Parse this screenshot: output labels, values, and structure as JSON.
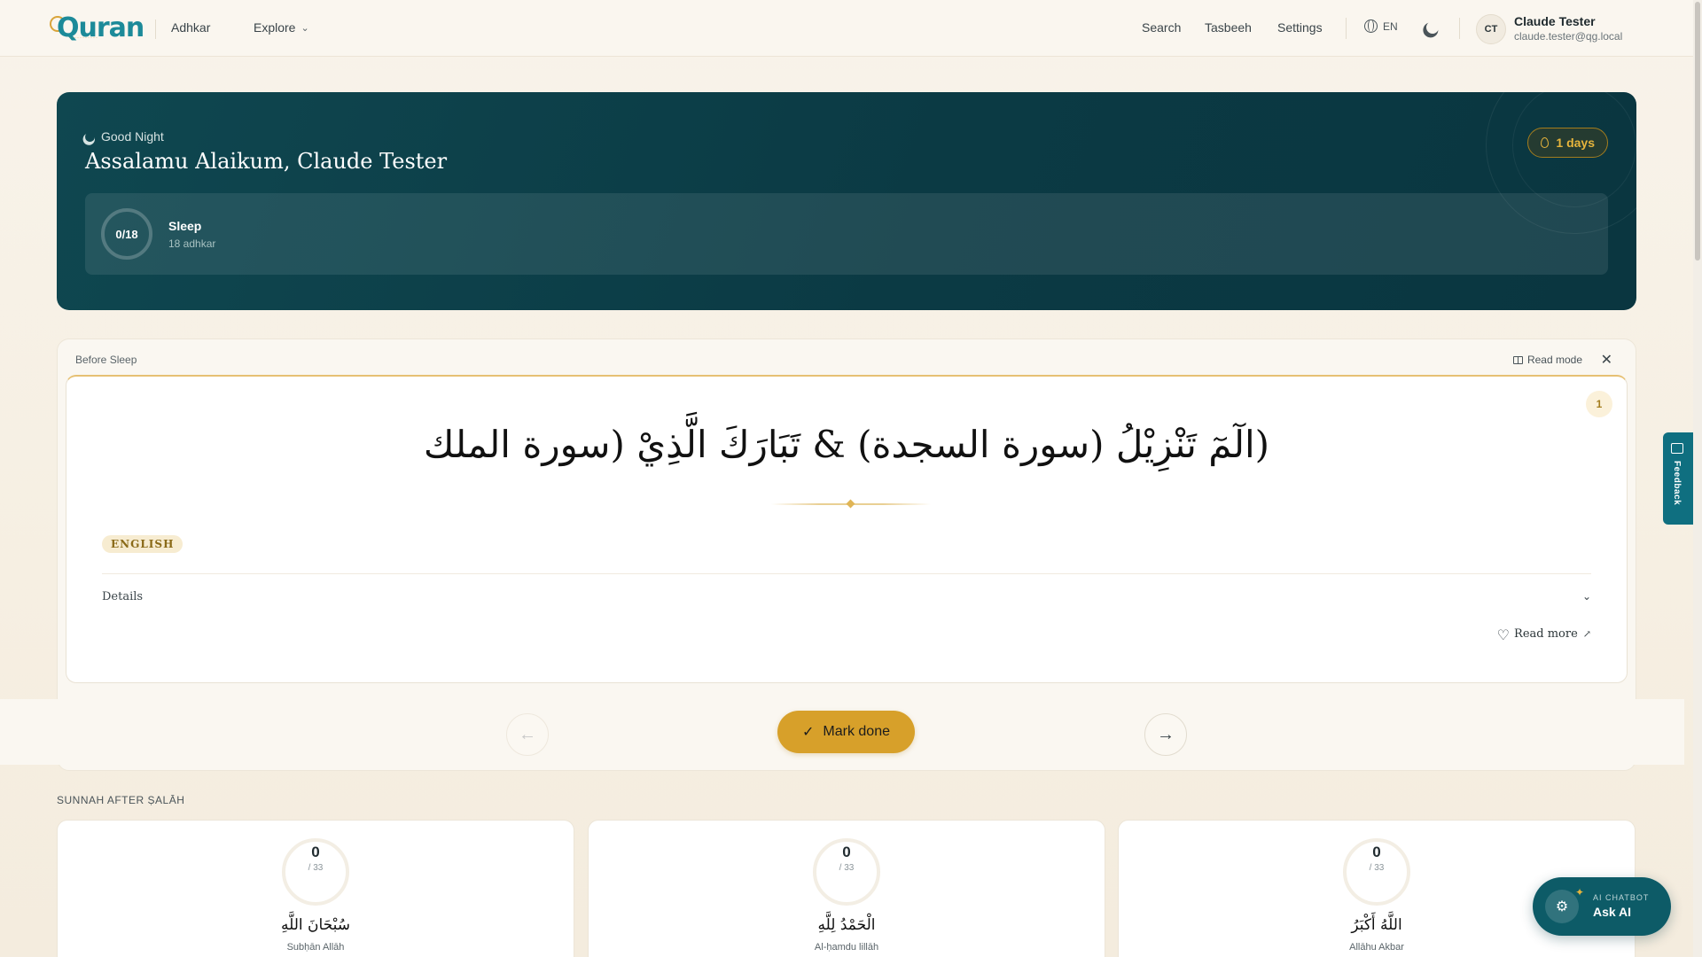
{
  "nav": {
    "logo": "Quran",
    "adhkar": "Adhkar",
    "explore": "Explore",
    "search": "Search",
    "tasbeeh": "Tasbeeh",
    "settings": "Settings",
    "lang": "EN",
    "avatar_initials": "CT",
    "user_name": "Claude Tester",
    "user_email": "claude.tester@qg.local"
  },
  "hero": {
    "greeting_small": "Good Night",
    "greeting": "Assalamu Alaikum, Claude Tester",
    "streak": "1 days",
    "progress": "0/18",
    "collection_title": "Sleep",
    "collection_sub": "18 adhkar"
  },
  "dhikr": {
    "section_label": "Before Sleep",
    "read_mode": "Read mode",
    "count": "1",
    "arabic": "(الٓمٓ تَنْزِيْلُ (سورة السجدة) & تَبَارَكَ الَّذِيْ (سورة الملك",
    "lang_badge": "ENGLISH",
    "details": "Details",
    "read_more": "Read more",
    "mark_done": "Mark done"
  },
  "sunnah": {
    "title": "SUNNAH AFTER ṢALĀH",
    "cards": [
      {
        "count": "0",
        "total": "/ 33",
        "arabic": "سُبْحَانَ اللَّهِ",
        "translit": "Subḥān Allāh"
      },
      {
        "count": "0",
        "total": "/ 33",
        "arabic": "الْحَمْدُ لِلَّهِ",
        "translit": "Al-ḥamdu lillāh"
      },
      {
        "count": "0",
        "total": "/ 33",
        "arabic": "اللَّهُ أَكْبَرُ",
        "translit": "Allāhu Akbar"
      }
    ]
  },
  "floating": {
    "feedback": "Feedback",
    "ai_small": "AI CHATBOT",
    "ai_big": "Ask AI"
  }
}
